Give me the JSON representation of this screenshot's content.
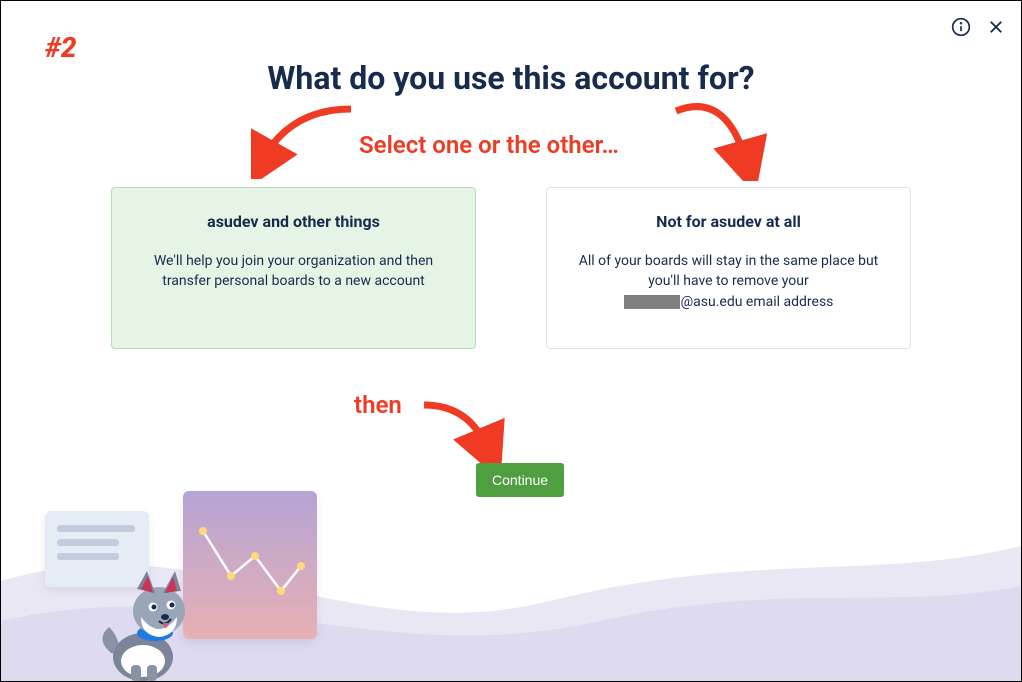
{
  "annotations": {
    "step_number": "#2",
    "select_instruction": "Select one or the other…",
    "then_label": "then"
  },
  "dialog": {
    "heading": "What do you use this account for?",
    "option_a": {
      "title": "asudev and other things",
      "description": "We'll help you join your organization and then transfer personal boards to a new account"
    },
    "option_b": {
      "title": "Not for asudev at all",
      "desc_line1": "All of your boards will stay in the same place but you'll have to remove your",
      "email_domain": "@asu.edu email address"
    },
    "continue_label": "Continue"
  },
  "colors": {
    "annotation_red": "#ef3b24",
    "text_navy": "#172b4d",
    "selected_bg": "#e6f4e6",
    "button_green": "#4f9e3f"
  }
}
